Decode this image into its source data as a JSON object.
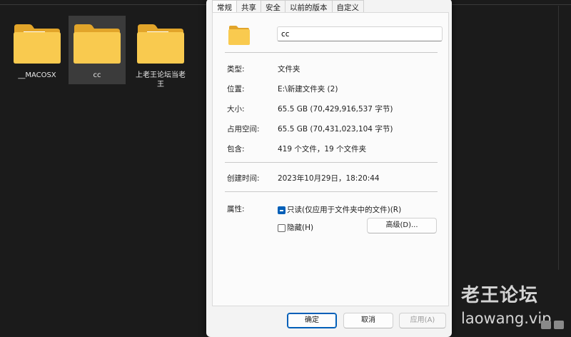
{
  "explorer": {
    "folders": [
      {
        "name": "__MACOSX",
        "selected": false,
        "has_paper": true
      },
      {
        "name": "cc",
        "selected": true,
        "has_paper": false
      },
      {
        "name": "上老王论坛当老王",
        "selected": false,
        "has_paper": true
      }
    ]
  },
  "dialog": {
    "tabs": [
      "常规",
      "共享",
      "安全",
      "以前的版本",
      "自定义"
    ],
    "active_tab": "常规",
    "folder_name": "cc",
    "props": {
      "type_label": "类型:",
      "type_value": "文件夹",
      "location_label": "位置:",
      "location_value": "E:\\新建文件夹 (2)",
      "size_label": "大小:",
      "size_value": "65.5 GB (70,429,916,537 字节)",
      "disk_label": "占用空间:",
      "disk_value": "65.5 GB (70,431,023,104 字节)",
      "contains_label": "包含:",
      "contains_value": "419 个文件，19 个文件夹",
      "created_label": "创建时间:",
      "created_value": "2023年10月29日，18:20:44",
      "attributes_label": "属性:"
    },
    "readonly_label": "只读(仅应用于文件夹中的文件)(R)",
    "hidden_label": "隐藏(H)",
    "advanced_button": "高级(D)...",
    "ok_button": "确定",
    "cancel_button": "取消",
    "apply_button": "应用(A)"
  },
  "watermark": {
    "cn": "老王论坛",
    "en": "laowang.vip"
  },
  "colors": {
    "accent": "#005fb8",
    "folder": "#f8c84a",
    "background": "#1b1b1b"
  }
}
